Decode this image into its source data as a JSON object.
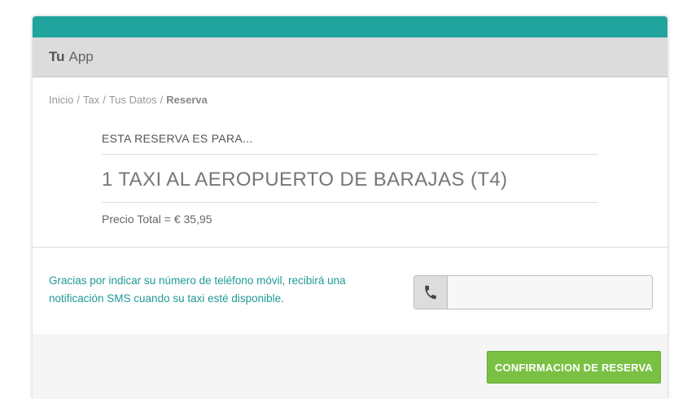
{
  "colors": {
    "accent": "#21a39e",
    "header_bg": "#dcdcdc",
    "note_text": "#1e9a96",
    "confirm_button": "#7ac143"
  },
  "header": {
    "brand_bold": "Tu",
    "brand_rest": "App"
  },
  "breadcrumb": {
    "items": [
      "Inicio",
      "Tax",
      "Tus Datos"
    ],
    "separator": "/",
    "current": "Reserva"
  },
  "summary": {
    "for_label": "ESTA RESERVA ES PARA...",
    "trip_title": "1 TAXI AL AEROPUERTO DE BARAJAS (T4)",
    "total": "Precio Total = € 35,95"
  },
  "phone": {
    "note": "Gracias por indicar su número de teléfono móvil, recibirá una notificación SMS cuando su taxi esté disponible.",
    "icon": "phone-icon",
    "value": "",
    "placeholder": ""
  },
  "footer": {
    "confirm_label": "CONFIRMACION DE RESERVA"
  }
}
